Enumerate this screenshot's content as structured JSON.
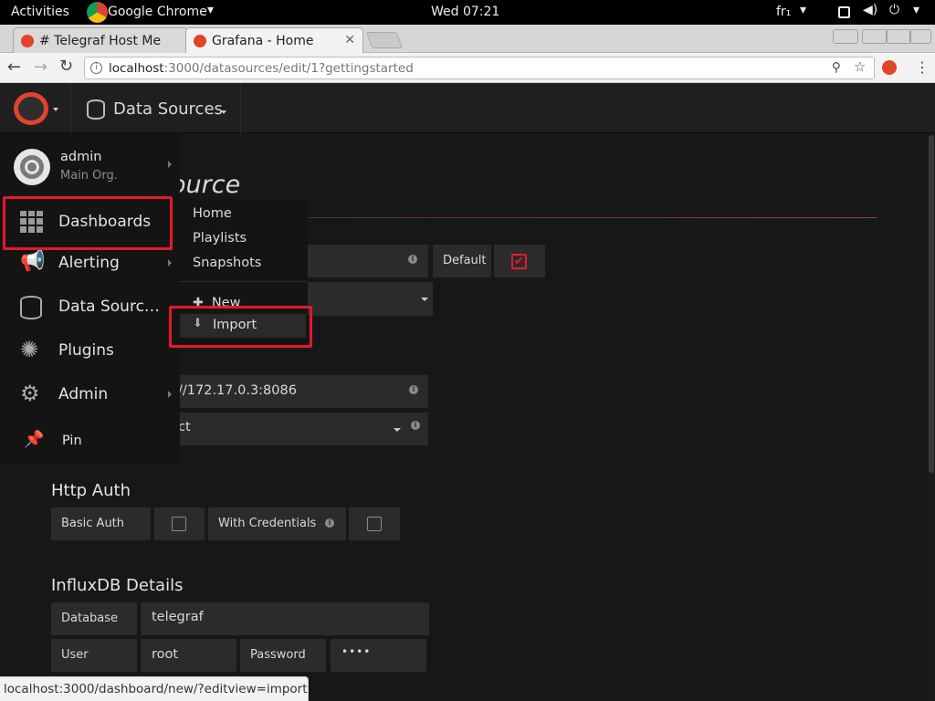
{
  "system": {
    "activities": "Activities",
    "app": "Google Chrome",
    "clock": "Wed 07:21",
    "lang": "fr₁"
  },
  "browser": {
    "tabs": [
      {
        "title": "# Telegraf Host Me"
      },
      {
        "title": "Grafana - Home"
      }
    ],
    "address": {
      "host": "localhost",
      "path": ":3000/datasources/edit/1?gettingstarted"
    }
  },
  "navbar": {
    "title": "Data Sources"
  },
  "sidemenu": {
    "user": {
      "name": "admin",
      "org": "Main Org."
    },
    "items": [
      {
        "label": "Dashboards"
      },
      {
        "label": "Alerting"
      },
      {
        "label": "Data Sourc…"
      },
      {
        "label": "Plugins"
      },
      {
        "label": "Admin"
      },
      {
        "label": "Pin"
      }
    ]
  },
  "submenu": {
    "items": [
      "Home",
      "Playlists",
      "Snapshots"
    ],
    "new_label": "New",
    "import_label": "Import"
  },
  "page": {
    "title_partial": "ource"
  },
  "form": {
    "default_label": "Default",
    "url_value": "//172.17.0.3:8086",
    "access_value": "ct",
    "http_auth": {
      "title": "Http Auth",
      "basic_auth": "Basic Auth",
      "with_credentials": "With Credentials"
    },
    "influx": {
      "title": "InfluxDB Details",
      "database_label": "Database",
      "database_value": "telegraf",
      "user_label": "User",
      "user_value": "root",
      "password_label": "Password",
      "password_value": "••••"
    }
  },
  "status_url": "localhost:3000/dashboard/new/?editview=import",
  "colors": {
    "accent_red": "#e8182c",
    "bg": "#161719",
    "panel": "#2b2b2c"
  }
}
